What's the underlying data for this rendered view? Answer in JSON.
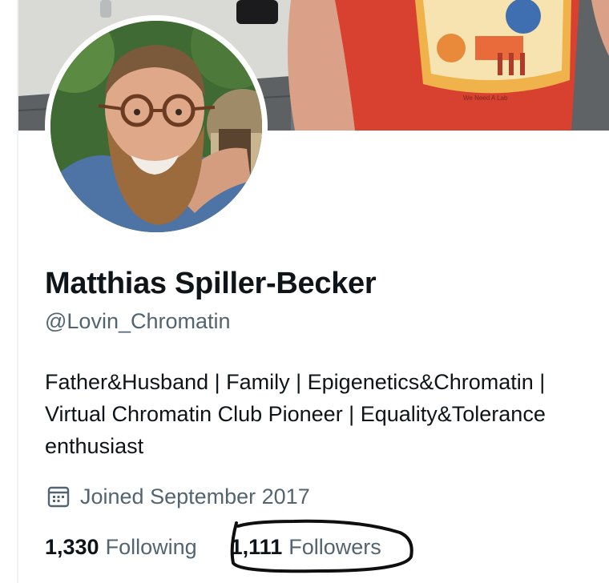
{
  "profile": {
    "display_name": "Matthias Spiller-Becker",
    "handle": "@Lovin_Chromatin",
    "bio_lines": [
      "Father&Husband | Family | Epigenetics&Chromatin |",
      "Virtual Chromatin Club Pioneer | Equality&Tolerance",
      "enthusiast"
    ],
    "joined": "Joined September 2017",
    "joined_icon": "calendar-icon"
  },
  "stats": {
    "following_count": "1,330",
    "following_label": "Following",
    "followers_count": "1,111",
    "followers_label": "Followers"
  },
  "colors": {
    "text_primary": "#0f1419",
    "text_secondary": "#536471",
    "annotation_ink": "#0f0f0f",
    "shirt_red": "#d8402f"
  }
}
